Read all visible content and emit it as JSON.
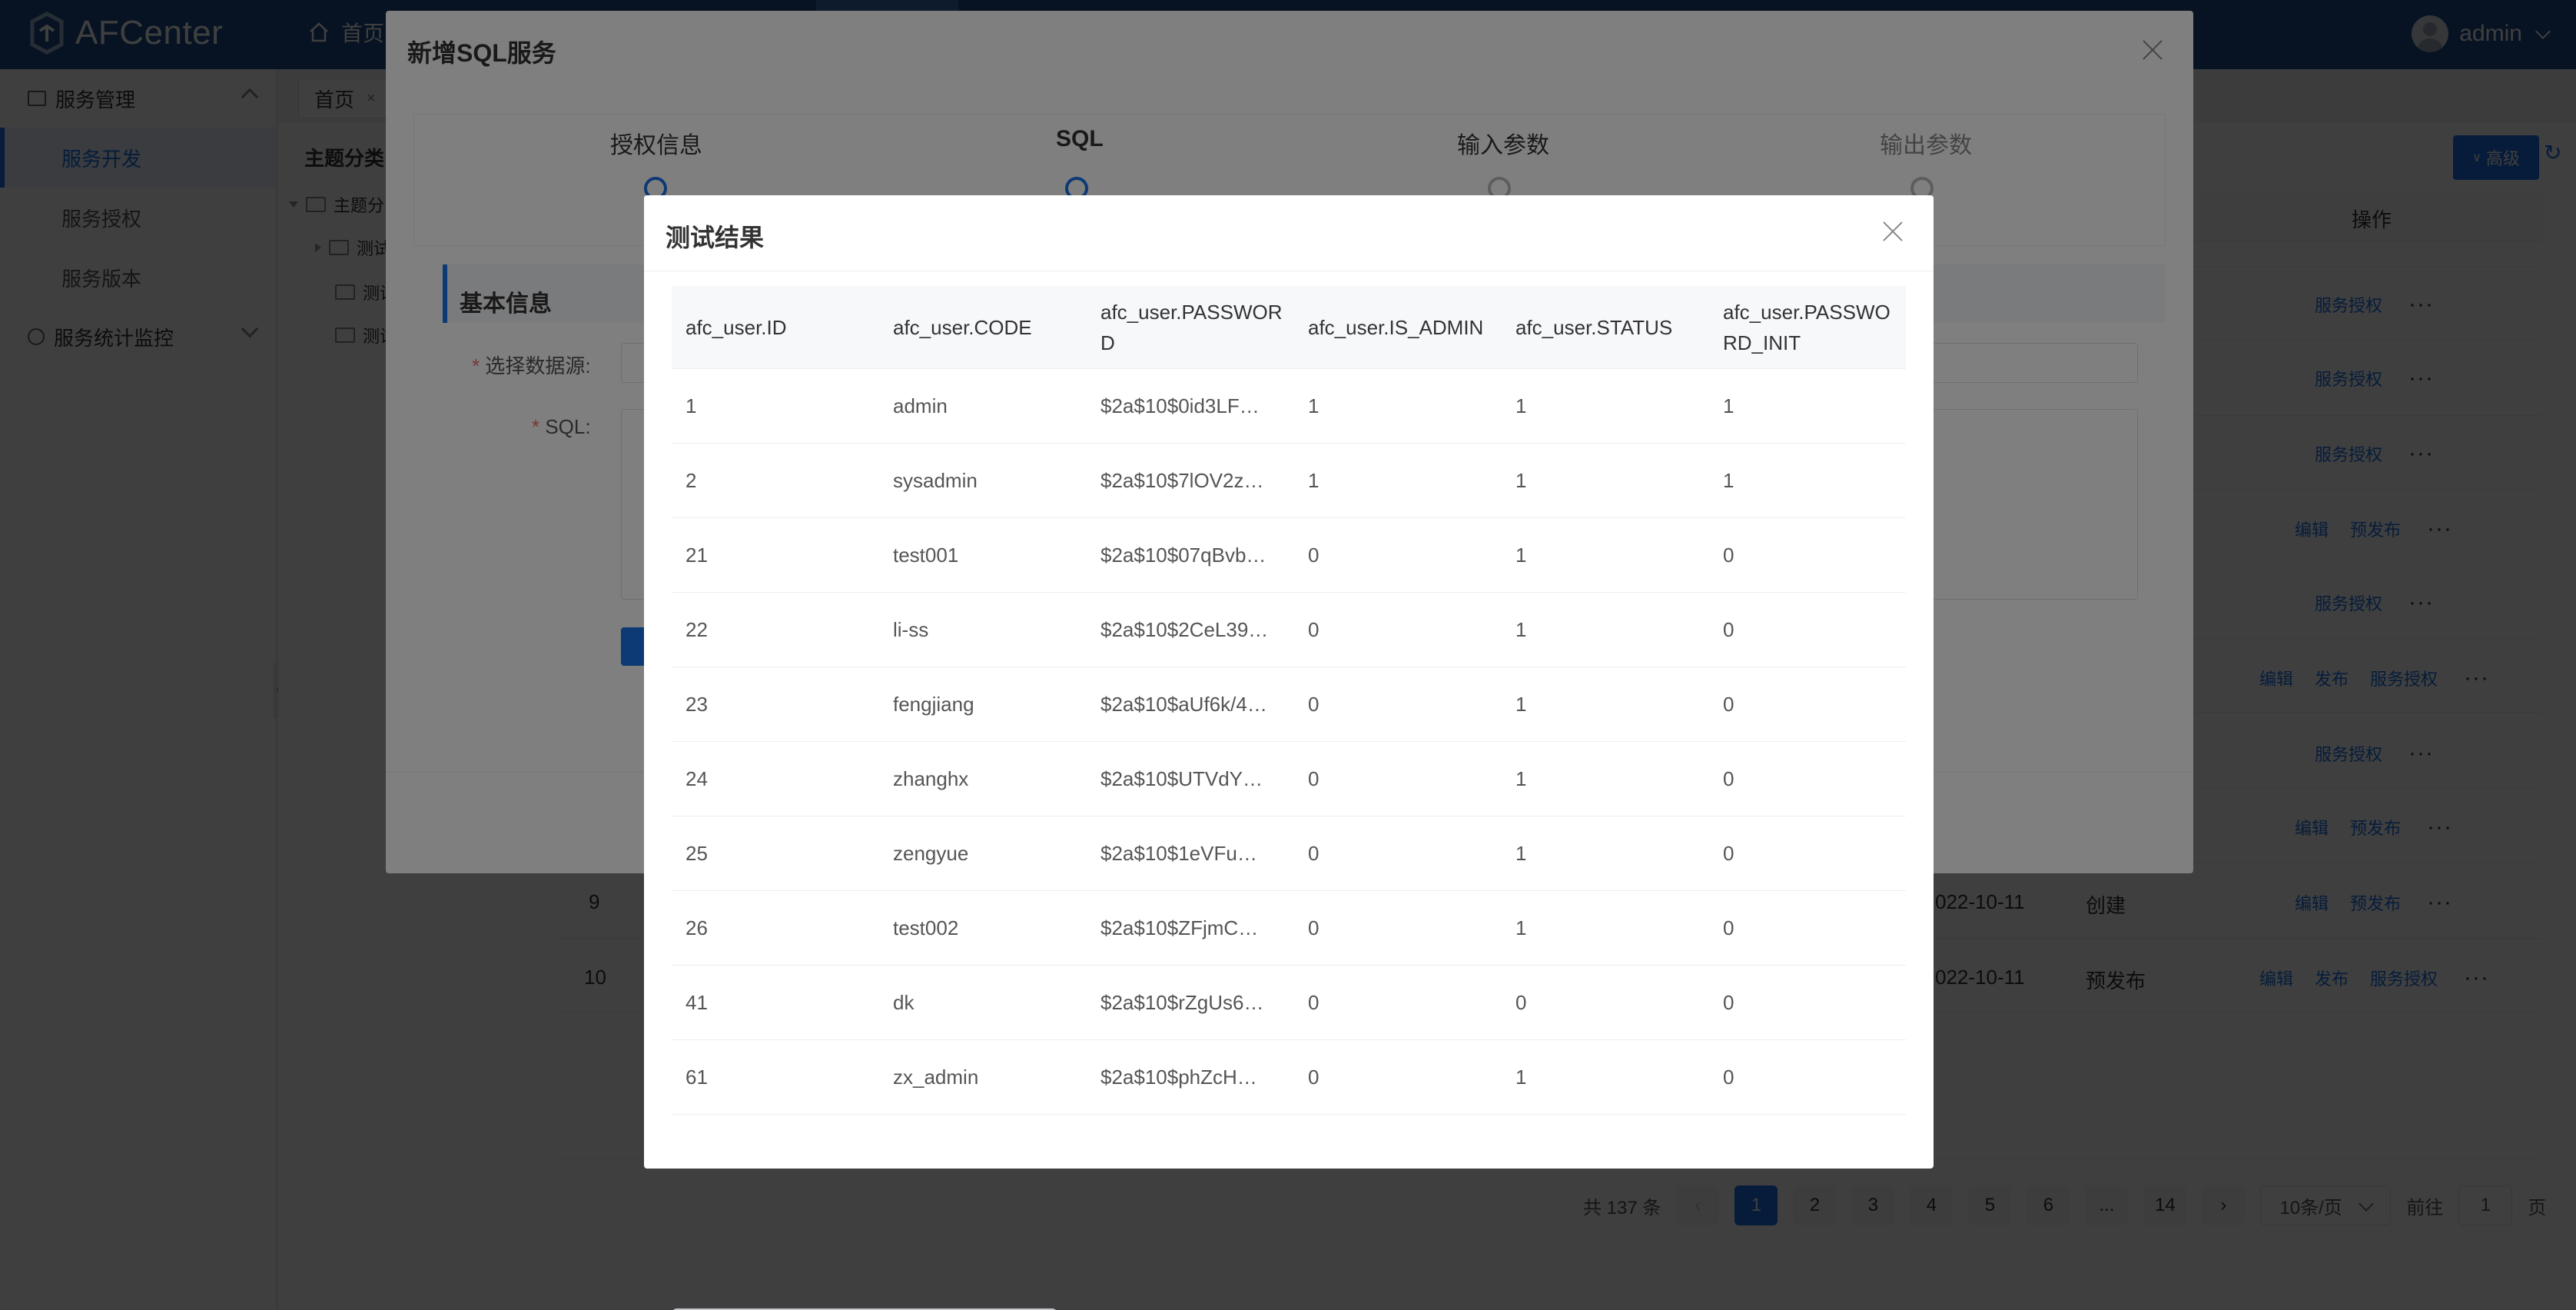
{
  "header": {
    "app_name": "AFCenter",
    "home_label": "首页",
    "user_name": "admin"
  },
  "sidebar": {
    "groups": [
      {
        "label": "服务管理",
        "icon": "book-icon",
        "expanded": true
      },
      {
        "label": "服务统计监控",
        "icon": "pie-chart-icon",
        "expanded": false
      }
    ],
    "items": [
      {
        "label": "服务开发",
        "active": true
      },
      {
        "label": "服务授权",
        "active": false
      },
      {
        "label": "服务版本",
        "active": false
      }
    ]
  },
  "tabs": {
    "home": "首页"
  },
  "tree": {
    "title": "主题分类",
    "root": "主题分",
    "children": [
      "测试",
      "测试",
      "测试"
    ]
  },
  "toolbar": {
    "advanced": "高级"
  },
  "bg_table": {
    "op_header": "操作",
    "rows": [
      {
        "ops": [
          "服务授权"
        ]
      },
      {
        "ops": [
          "服务授权"
        ]
      },
      {
        "ops": [
          "服务授权"
        ]
      },
      {
        "ops": [
          "编辑",
          "预发布"
        ]
      },
      {
        "ops": [
          "服务授权"
        ]
      },
      {
        "ops": [
          "编辑",
          "发布",
          "服务授权"
        ]
      },
      {
        "ops": [
          "服务授权"
        ]
      },
      {
        "ops": [
          "编辑",
          "预发布"
        ]
      },
      {
        "no": "9",
        "date": "022-10-11",
        "status": "创建",
        "ops": [
          "编辑",
          "预发布"
        ]
      },
      {
        "no": "10",
        "date": "022-10-11",
        "status": "预发布",
        "ops": [
          "编辑",
          "发布",
          "服务授权"
        ]
      }
    ]
  },
  "pagination": {
    "total": "共 137 条",
    "pages": [
      "1",
      "2",
      "3",
      "4",
      "5",
      "6",
      "...",
      "14"
    ],
    "current": "1",
    "page_size": "10条/页",
    "goto_label": "前往",
    "goto_value": "1",
    "page_suffix": "页"
  },
  "dialog_add": {
    "title": "新增SQL服务",
    "steps": [
      "授权信息",
      "SQL",
      "输入参数",
      "输出参数"
    ],
    "section_title": "基本信息",
    "datasource_label": "选择数据源:",
    "sql_label": "SQL:"
  },
  "dialog_result": {
    "title": "测试结果",
    "columns": [
      "afc_user.ID",
      "afc_user.CODE",
      "afc_user.PASSWORD",
      "afc_user.IS_ADMIN",
      "afc_user.STATUS",
      "afc_user.PASSWORD_INIT"
    ],
    "rows": [
      [
        "1",
        "admin",
        "$2a$10$0id3LF…",
        "1",
        "1",
        "1"
      ],
      [
        "2",
        "sysadmin",
        "$2a$10$7lOV2z…",
        "1",
        "1",
        "1"
      ],
      [
        "21",
        "test001",
        "$2a$10$07qBvb…",
        "0",
        "1",
        "0"
      ],
      [
        "22",
        "li-ss",
        "$2a$10$2CeL39…",
        "0",
        "1",
        "0"
      ],
      [
        "23",
        "fengjiang",
        "$2a$10$aUf6k/4…",
        "0",
        "1",
        "0"
      ],
      [
        "24",
        "zhanghx",
        "$2a$10$UTVdY…",
        "0",
        "1",
        "0"
      ],
      [
        "25",
        "zengyue",
        "$2a$10$1eVFu…",
        "0",
        "1",
        "0"
      ],
      [
        "26",
        "test002",
        "$2a$10$ZFjmC…",
        "0",
        "1",
        "0"
      ],
      [
        "41",
        "dk",
        "$2a$10$rZgUs6…",
        "0",
        "0",
        "0"
      ],
      [
        "61",
        "zx_admin",
        "$2a$10$phZcH…",
        "0",
        "1",
        "0"
      ]
    ]
  },
  "colors": {
    "header_bg": "#1f4d8c",
    "primary": "#1a73e8"
  }
}
